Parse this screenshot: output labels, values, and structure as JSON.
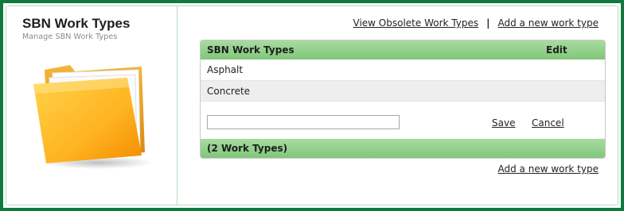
{
  "header": {
    "title": "SBN Work Types",
    "subtitle": "Manage SBN Work Types"
  },
  "links": {
    "view_obsolete": "View Obsolete Work Types",
    "separator": "|",
    "add_new_top": "Add a new work type",
    "add_new_bottom": "Add a new work type"
  },
  "grid": {
    "columns": {
      "name": "SBN Work Types",
      "edit": "Edit"
    },
    "rows": [
      {
        "name": "Asphalt"
      },
      {
        "name": "Concrete"
      }
    ],
    "new_row": {
      "input_value": "",
      "save_label": "Save",
      "cancel_label": "Cancel"
    },
    "footer": "(2 Work Types)"
  },
  "colors": {
    "frame": "#0f7a3e",
    "grid_header": "#8fcf87",
    "folder": "#f5a623"
  },
  "icons": {
    "hero": "folder-icon"
  }
}
